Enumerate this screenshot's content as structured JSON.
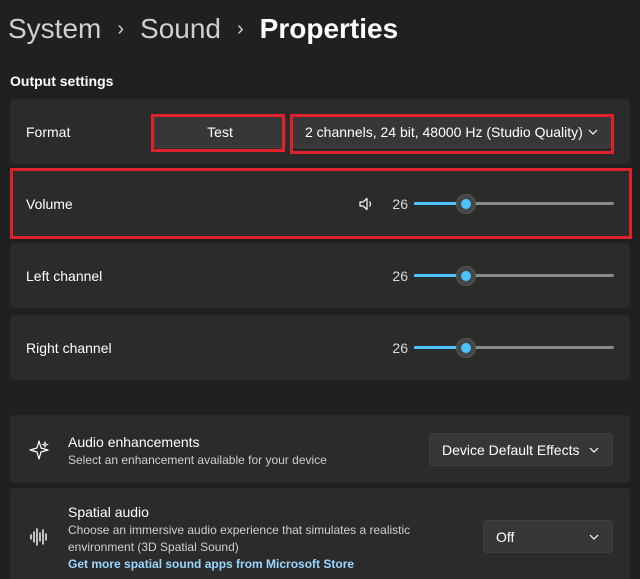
{
  "breadcrumb": {
    "item1": "System",
    "item2": "Sound",
    "current": "Properties"
  },
  "output_section": {
    "title": "Output settings",
    "format": {
      "label": "Format",
      "test_button": "Test",
      "dropdown_value": "2 channels, 24 bit, 48000 Hz (Studio Quality)"
    },
    "volume": {
      "label": "Volume",
      "value": "26",
      "level": 26,
      "max": 100
    },
    "left_channel": {
      "label": "Left channel",
      "value": "26",
      "level": 26,
      "max": 100
    },
    "right_channel": {
      "label": "Right channel",
      "value": "26",
      "level": 26,
      "max": 100
    }
  },
  "audio_enhancements": {
    "title": "Audio enhancements",
    "description": "Select an enhancement available for your device",
    "dropdown_value": "Device Default Effects",
    "icon": "sparkle-icon"
  },
  "spatial_audio": {
    "title": "Spatial audio",
    "description_line1": "Choose an immersive audio experience that simulates a realistic",
    "description_line2": "environment (3D Spatial Sound)",
    "link": "Get more spatial sound apps from Microsoft Store",
    "dropdown_value": "Off",
    "icon": "soundwave-icon"
  },
  "colors": {
    "accent": "#4cc2ff",
    "highlight": "#e0202a",
    "card": "#2b2b2b",
    "background": "#202020"
  }
}
